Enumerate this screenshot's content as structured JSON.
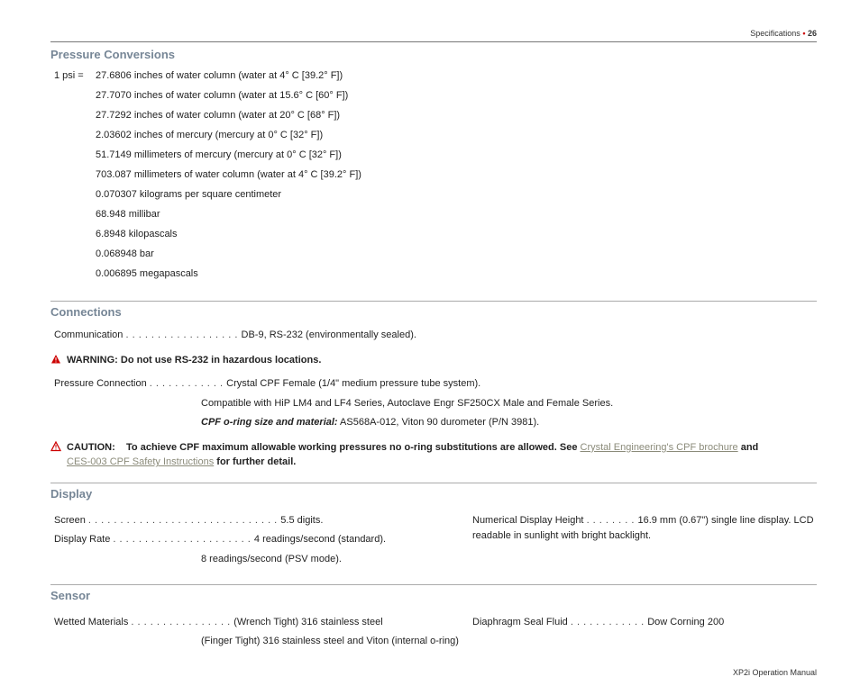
{
  "header": {
    "section": "Specifications",
    "page_number": "26"
  },
  "pressure_conversions": {
    "heading": "Pressure Conversions",
    "label": "1 psi =",
    "items": [
      "27.6806 inches of water column (water at 4° C [39.2° F])",
      "27.7070 inches of water column (water at 15.6° C [60° F])",
      "27.7292 inches of water column (water at 20° C [68° F])",
      "2.03602 inches of mercury (mercury at 0° C [32° F])",
      "51.7149 millimeters of mercury (mercury at 0° C [32° F])",
      "703.087 millimeters of water column (water at 4° C [39.2° F])",
      "0.070307 kilograms per square centimeter",
      "68.948 millibar",
      "6.8948 kilopascals",
      "0.068948 bar",
      "0.006895 megapascals"
    ]
  },
  "connections": {
    "heading": "Connections",
    "communication": {
      "label": "Communication",
      "value": "DB-9, RS-232 (environmentally sealed)."
    },
    "warning": {
      "label": "WARNING:",
      "text": "Do not use RS-232 in hazardous locations."
    },
    "pressure_connection": {
      "label": "Pressure Connection",
      "value": "Crystal CPF Female (1/4\" medium pressure tube system).",
      "compat": "Compatible with HiP LM4 and LF4 Series, Autoclave Engr SF250CX Male and Female Series.",
      "oring_label": "CPF o-ring size and material:",
      "oring_value": "AS568A-012, Viton 90 durometer (P/N 3981)."
    },
    "caution": {
      "label": "CAUTION:",
      "text_before": "To achieve CPF maximum allowable working pressures no o-ring substitutions are allowed. See ",
      "link1": "Crystal Engineering's CPF brochure",
      "text_mid": " and ",
      "link2": "CES-003 CPF Safety Instructions",
      "text_after": " for further detail."
    }
  },
  "display": {
    "heading": "Display",
    "screen": {
      "label": "Screen",
      "value": "5.5 digits."
    },
    "rate": {
      "label": "Display Rate",
      "value1": "4 readings/second (standard).",
      "value2": "8 readings/second (PSV mode)."
    },
    "ndh": {
      "label": "Numerical Display Height",
      "value": "16.9 mm (0.67\") single line display. LCD readable in sunlight with bright backlight."
    }
  },
  "sensor": {
    "heading": "Sensor",
    "wetted": {
      "label": "Wetted Materials",
      "value1": "(Wrench Tight) 316 stainless steel",
      "value2": "(Finger Tight) 316 stainless steel and Viton (internal o-ring)"
    },
    "seal": {
      "label": "Diaphragm Seal Fluid",
      "value": "Dow Corning 200"
    }
  },
  "footer": {
    "text": "XP2i Operation Manual"
  }
}
